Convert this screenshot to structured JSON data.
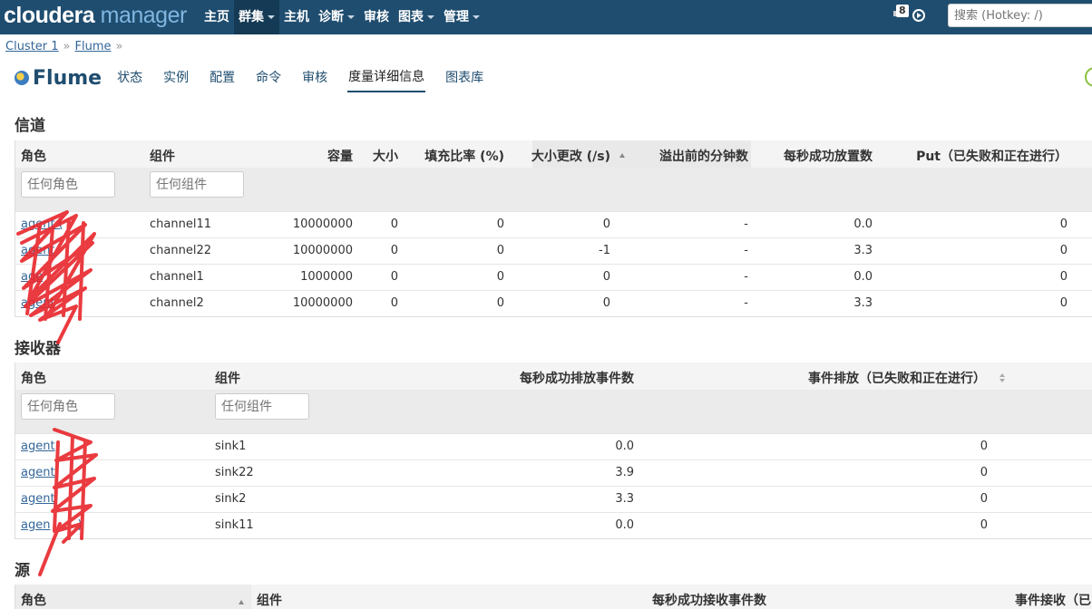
{
  "app": {
    "logo_main": "cloudera",
    "logo_sub": " manager"
  },
  "nav": {
    "items": [
      {
        "label": "主页",
        "caret": false
      },
      {
        "label": "群集",
        "caret": true,
        "active": true
      },
      {
        "label": "主机",
        "caret": false
      },
      {
        "label": "诊断",
        "caret": true
      },
      {
        "label": "审核",
        "caret": false
      },
      {
        "label": "图表",
        "caret": true
      },
      {
        "label": "管理",
        "caret": true
      }
    ],
    "badge_count": "8",
    "search_placeholder": "搜索 (Hotkey: /)"
  },
  "breadcrumb": {
    "cluster": "Cluster 1",
    "service": "Flume",
    "sep": "»"
  },
  "service": {
    "title": "Flume",
    "tabs": [
      "状态",
      "实例",
      "配置",
      "命令",
      "审核",
      "度量详细信息",
      "图表库"
    ],
    "active_tab": "度量详细信息"
  },
  "channels": {
    "title": "信道",
    "headers": [
      "角色",
      "组件",
      "容量",
      "大小",
      "填充比率 (%)",
      "大小更改 (/s)",
      "溢出前的分钟数",
      "每秒成功放置数",
      "Put（已失败和正在进行）"
    ],
    "filter_role": "任何角色",
    "filter_component": "任何组件",
    "rows": [
      [
        "agent (",
        "channel11",
        "10000000",
        "0",
        "0",
        "0",
        "-",
        "0.0",
        "0"
      ],
      [
        "agent",
        "channel22",
        "10000000",
        "0",
        "0",
        "-1",
        "-",
        "3.3",
        "0"
      ],
      [
        "age",
        "channel1",
        "1000000",
        "0",
        "0",
        "0",
        "-",
        "0.0",
        "0"
      ],
      [
        "agent",
        "channel2",
        "10000000",
        "0",
        "0",
        "0",
        "-",
        "3.3",
        "0"
      ]
    ]
  },
  "sinks": {
    "title": "接收器",
    "headers": [
      "角色",
      "组件",
      "每秒成功排放事件数",
      "事件排放（已失败和正在进行）"
    ],
    "filter_role": "任何角色",
    "filter_component": "任何组件",
    "rows": [
      [
        "agent",
        "sink1",
        "0.0",
        "0"
      ],
      [
        "agent",
        "sink22",
        "3.9",
        "0"
      ],
      [
        "agent",
        "sink2",
        "3.3",
        "0"
      ],
      [
        "agen",
        "sink11",
        "0.0",
        "0"
      ]
    ],
    "row_suffix_3": ")"
  },
  "sources": {
    "title": "源",
    "headers": [
      "角色",
      "组件",
      "每秒成功接收事件数",
      "事件接收（已"
    ]
  },
  "colors": {
    "nav_bg": "#1f4d6f",
    "link": "#336699",
    "scribble": "#e8262b"
  }
}
